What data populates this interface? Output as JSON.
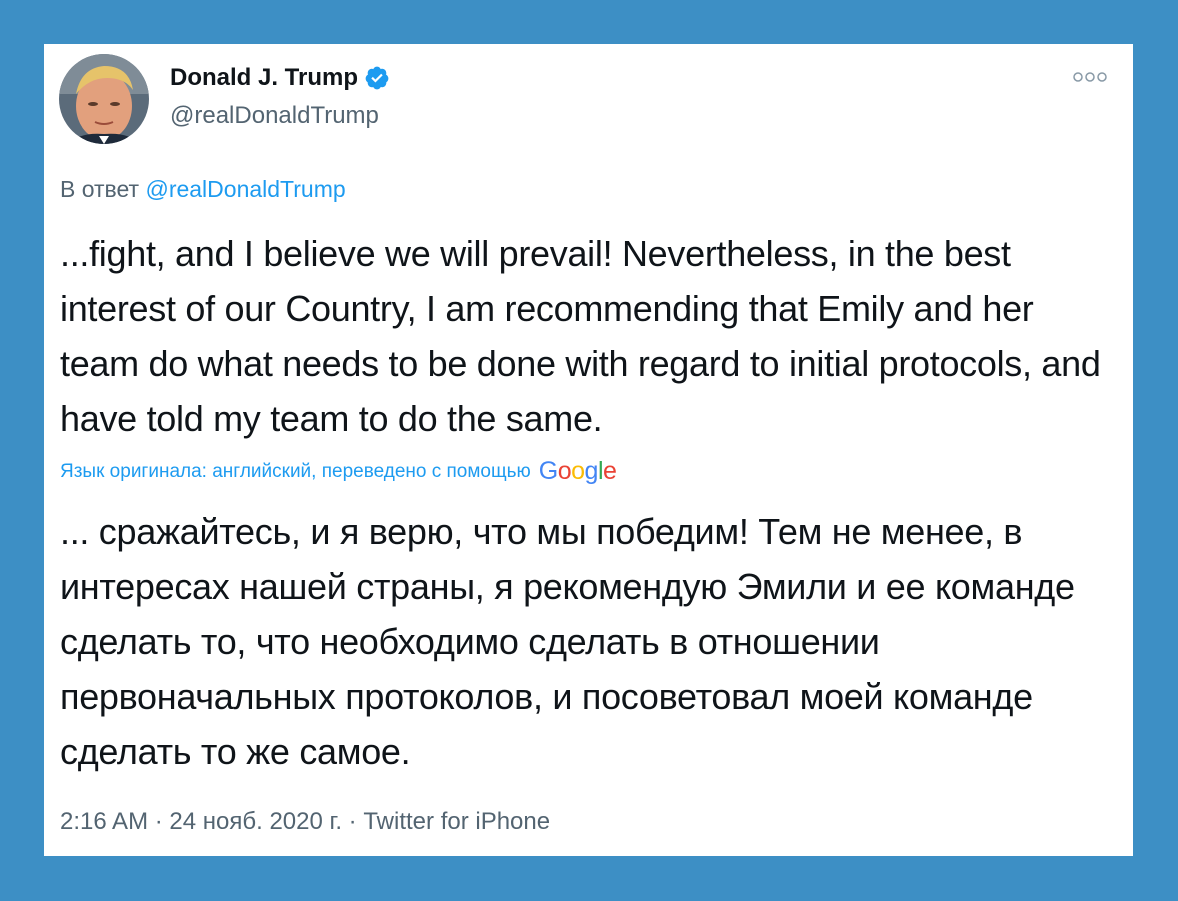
{
  "colors": {
    "background": "#3d8fc5",
    "link": "#1d9bf0",
    "text": "#0f1419",
    "secondary": "#536471",
    "verified": "#1d9bf0"
  },
  "tweet": {
    "author": {
      "display_name": "Donald J. Trump",
      "handle": "@realDonaldTrump",
      "verified": true,
      "verified_icon": "verified-badge-icon",
      "avatar_icon": "profile-avatar"
    },
    "more_icon": "more-options-icon",
    "reply_prefix": "В ответ",
    "reply_to": "@realDonaldTrump",
    "text": "...fight, and I believe we will prevail! Nevertheless, in the best interest of our Country, I am recommending that Emily and her team do what needs to be done with regard to initial protocols, and have told my team to do the same.",
    "translation_note": "Язык оригинала: английский, переведено с помощью",
    "translation_provider": {
      "letters": [
        "G",
        "o",
        "o",
        "g",
        "l",
        "e"
      ]
    },
    "translated_text": "... сражайтесь, и я верю, что мы победим! Тем не менее, в интересах нашей страны, я рекомендую Эмили и ее команде сделать то, что необходимо сделать в отношении первоначальных протоколов, и посоветовал моей команде сделать то же самое.",
    "time": "2:16 AM",
    "separator": "·",
    "date": "24 нояб. 2020 г.",
    "source": "Twitter for iPhone"
  }
}
